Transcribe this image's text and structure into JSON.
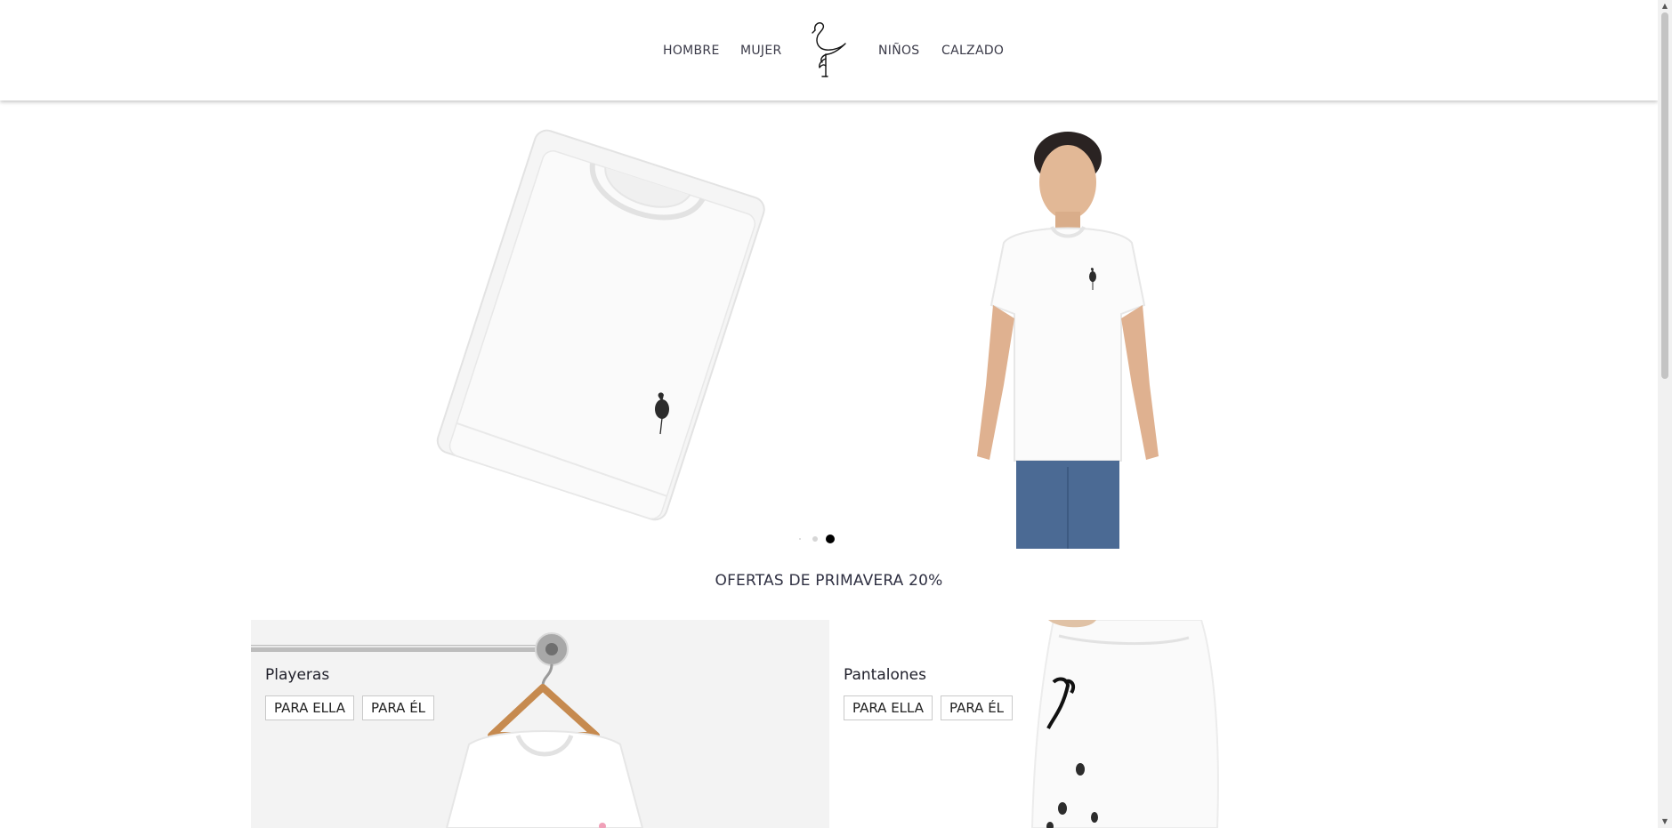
{
  "nav": {
    "left": [
      "HOMBRE",
      "MUJER"
    ],
    "right": [
      "NIÑOS",
      "CALZADO"
    ],
    "logo_icon": "flamingo-logo-icon"
  },
  "carousel": {
    "slide_count": 3,
    "active_slide": 3
  },
  "offer": {
    "text": "OFERTAS DE PRIMAVERA 20%"
  },
  "categories": [
    {
      "title": "Playeras",
      "buttons": [
        "PARA ELLA",
        "PARA ÉL"
      ]
    },
    {
      "title": "Pantalones",
      "buttons": [
        "PARA ELLA",
        "PARA ÉL"
      ]
    }
  ],
  "colors": {
    "nav_text": "#3a3a48",
    "offer_text": "#2f3042",
    "dot_active": "#000000",
    "dot_inactive": "#d6d6d6"
  }
}
